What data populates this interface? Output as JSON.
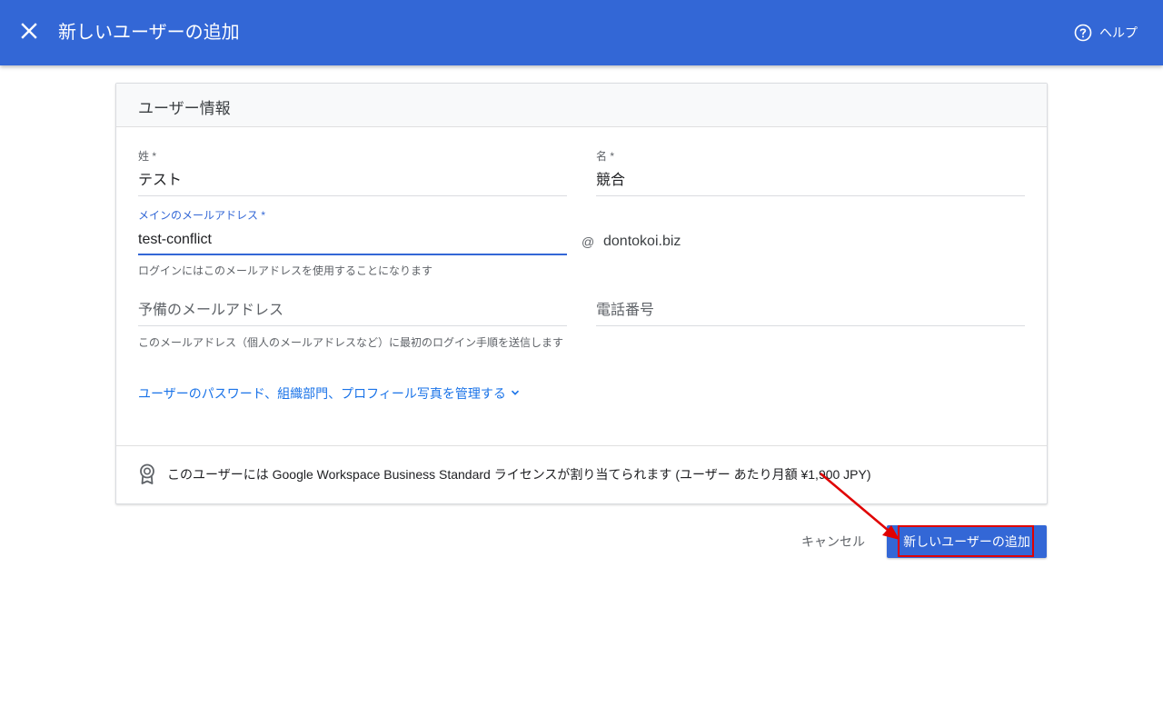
{
  "header": {
    "title": "新しいユーザーの追加",
    "help_label": "ヘルプ",
    "close_icon": "close-icon",
    "help_icon": "help-circle-icon",
    "bg_color": "#3367d6"
  },
  "section": {
    "title": "ユーザー情報"
  },
  "form": {
    "last_name": {
      "label": "姓 *",
      "value": "テスト"
    },
    "first_name": {
      "label": "名 *",
      "value": "競合"
    },
    "email": {
      "label": "メインのメールアドレス *",
      "value": "test-conflict",
      "hint": "ログインにはこのメールアドレスを使用することになります",
      "at": "@",
      "domain": "dontokoi.biz"
    },
    "secondary_email": {
      "placeholder": "予備のメールアドレス",
      "hint": "このメールアドレス（個人のメールアドレスなど）に最初のログイン手順を送信します"
    },
    "phone": {
      "placeholder": "電話番号"
    },
    "manage_link": "ユーザーのパスワード、組織部門、プロフィール写真を管理する"
  },
  "license": {
    "text": "このユーザーには Google Workspace Business Standard ライセンスが割り当てられます (ユーザー あたり月額 ¥1,900 JPY)",
    "icon": "award-badge-icon"
  },
  "actions": {
    "cancel_label": "キャンセル",
    "add_label": "新しいユーザーの追加"
  },
  "colors": {
    "accent": "#3367d6",
    "link": "#1a73e8",
    "annotation": "#e00000"
  }
}
